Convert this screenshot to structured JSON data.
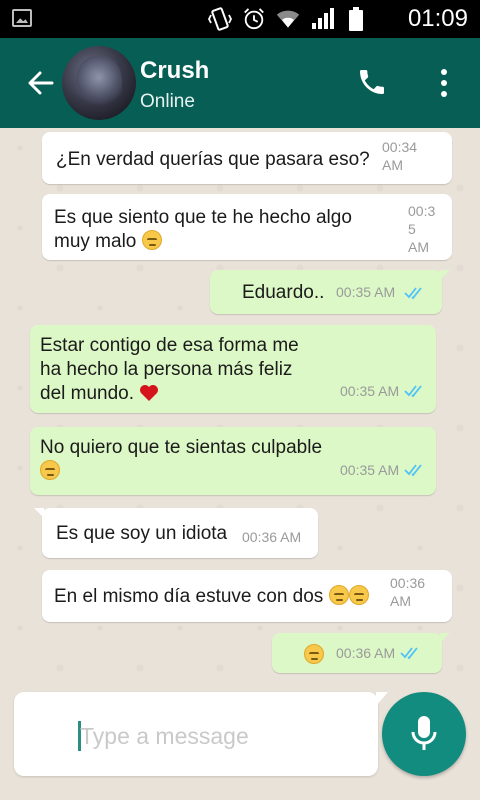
{
  "status_bar": {
    "time": "01:09"
  },
  "header": {
    "contact_name": "Crush",
    "contact_status": "Online"
  },
  "messages": [
    {
      "dir": "in",
      "text": "¿En verdad querías que pasara eso?",
      "time_line1": "00:34",
      "time_line2": "AM"
    },
    {
      "dir": "in",
      "text_line1": "Es que siento que te he hecho algo",
      "text_line2": "muy malo",
      "time_line1": "00:3",
      "time_line2": "5",
      "time_line3": "AM"
    },
    {
      "dir": "out",
      "text": "Eduardo..",
      "time": "00:35 AM"
    },
    {
      "dir": "out",
      "text_line1": "Estar contigo de esa forma me",
      "text_line2": "ha hecho la persona más feliz",
      "text_line3": "del mundo.",
      "time": "00:35 AM"
    },
    {
      "dir": "out",
      "text": "No quiero que te sientas culpable",
      "time": "00:35 AM"
    },
    {
      "dir": "in",
      "text": "Es que soy un idiota",
      "time": "00:36 AM"
    },
    {
      "dir": "in",
      "text": "En el mismo día estuve con dos",
      "time_line1": "00:36",
      "time_line2": "AM"
    },
    {
      "dir": "out",
      "text": "",
      "time": "00:36 AM"
    }
  ],
  "composer": {
    "placeholder": "Type a message"
  },
  "colors": {
    "header": "#075e54",
    "outgoing": "#dcf8c6",
    "incoming": "#ffffff",
    "mic": "#128c7e",
    "ticks": "#4fc3f7"
  },
  "icons": [
    "image-icon",
    "vibrate-icon",
    "alarm-icon",
    "wifi-icon",
    "signal-icon",
    "battery-icon",
    "back-arrow-icon",
    "call-icon",
    "more-vert-icon",
    "double-check-icon",
    "mic-icon",
    "pensive-emoji",
    "heart-emoji"
  ]
}
